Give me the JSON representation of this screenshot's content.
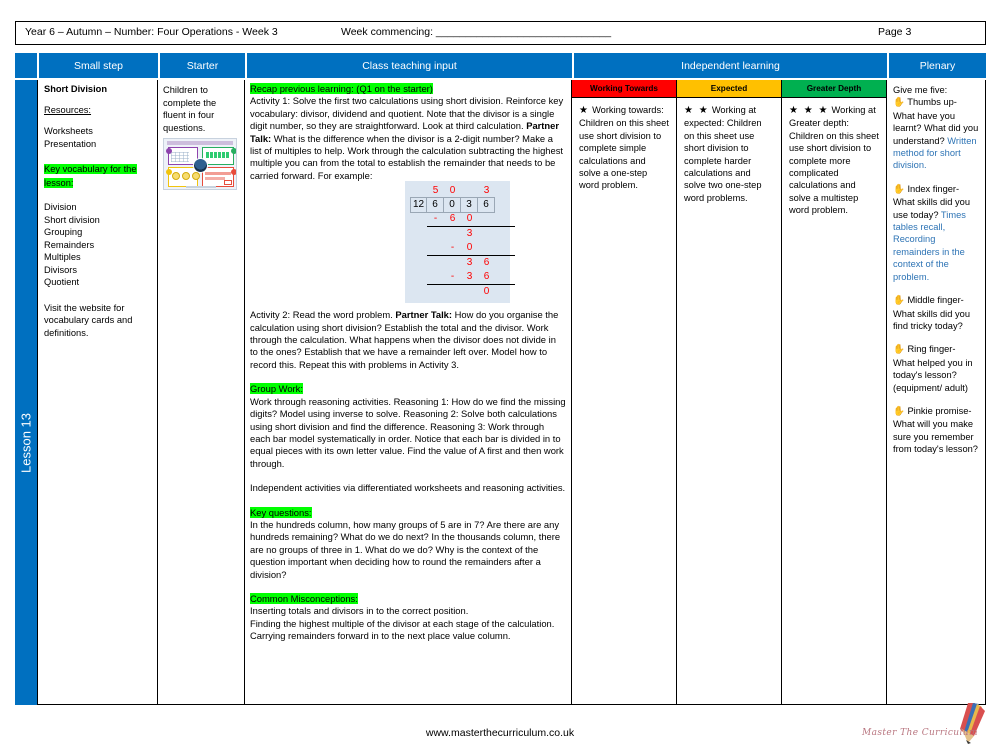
{
  "topbar": {
    "title": "Year 6 – Autumn – Number: Four Operations - Week 3",
    "week_commencing": "Week commencing: ______________________________",
    "page": "Page 3"
  },
  "headers": {
    "small_step": "Small step",
    "starter": "Starter",
    "class_teaching_input": "Class teaching input",
    "independent_learning": "Independent learning",
    "plenary": "Plenary"
  },
  "lesson_label": "Lesson 13",
  "small_step": {
    "title": "Short Division",
    "resources_label": "Resources:",
    "resources": [
      "Worksheets",
      "Presentation"
    ],
    "vocab_heading": "Key vocabulary for the lesson:",
    "vocabulary": [
      "Division",
      "Short division",
      "Grouping",
      "Remainders",
      "Multiples",
      "Divisors",
      "Quotient"
    ],
    "website_note": "Visit the website for vocabulary cards and definitions."
  },
  "starter": {
    "text": "Children to complete the fluent in four questions.",
    "thumbnail_alt": "fluent-in-four-worksheet-thumbnail"
  },
  "class_teaching": {
    "recap_heading": "Recap previous learning: (Q1 on the starter)",
    "activity1_pre": "Activity 1: Solve the first two calculations using short division. Reinforce key vocabulary: divisor, dividend and quotient. Note that the divisor is a single digit number, so they are straightforward. Look at third calculation. ",
    "partner_talk_1": "Partner Talk:",
    "activity1_post": " What is the difference  when the divisor is a 2-digit number? Make a list of multiples to help. Work through the calculation subtracting the highest multiple you can from the total to establish the remainder that needs to be carried forward. For example:",
    "activity2_pre": "Activity 2: Read the word problem. ",
    "partner_talk_2": "Partner Talk:",
    "activity2_post": " How do you organise the calculation using short division? Establish the total and the divisor. Work through the calculation. What happens when the divisor does not divide in to the ones? Establish that we have a remainder left over. Model how to record this.  Repeat this with problems in Activity 3.",
    "group_work_heading": "Group Work:",
    "group_work_text": "Work through reasoning activities. Reasoning 1: How do we find the missing digits? Model using inverse to solve. Reasoning 2: Solve both calculations using short division and find the difference. Reasoning 3: Work through each bar model systematically in order. Notice that each bar is divided in to equal pieces with its own letter value. Find the value of A first and then work through.",
    "independent_text": "Independent activities via differentiated worksheets and reasoning activities.",
    "key_questions_heading": "Key questions:",
    "key_questions_text": "In the hundreds column, how many groups of 5 are in 7? Are there are any hundreds remaining? What do we do next? In the thousands column, there are no groups of three in 1. What do we do? Why is the context of the question important when deciding how to round the remainders after a division?",
    "misconceptions_heading": "Common Misconceptions:",
    "misconceptions": [
      "Inserting totals and divisors in to the correct position.",
      "Finding the highest multiple of the divisor at each stage of the calculation.",
      "Carrying remainders forward in to the next place value column."
    ],
    "division_example": {
      "quotient": [
        "5",
        "0",
        "3"
      ],
      "divisor": "12",
      "dividend": [
        "6",
        "0",
        "3",
        "6"
      ],
      "step1_subtract": [
        "-",
        "6",
        "0"
      ],
      "step1_remainder": "3",
      "step2_subtract": [
        "-",
        "0"
      ],
      "step2_bring_down": [
        "3",
        "6"
      ],
      "step3_subtract": [
        "-",
        "3",
        "6"
      ],
      "final_remainder": "0"
    }
  },
  "independent_learning": {
    "bands": [
      {
        "label": "Working Towards",
        "color": "#FF0000",
        "stars": "★",
        "star_count": 1,
        "title": "Working towards:",
        "text": "Children on this sheet use short division to complete simple calculations and solve a one-step word problem."
      },
      {
        "label": "Expected",
        "color": "#FFC000",
        "stars": "★ ★",
        "star_count": 2,
        "title": "Working at expected:",
        "text": "Children on this sheet use short division to complete harder calculations and solve two one-step word problems."
      },
      {
        "label": "Greater Depth",
        "color": "#00B050",
        "stars": "★ ★ ★",
        "star_count": 3,
        "title": "Working at Greater depth:",
        "text": "Children on this sheet use short division to complete more complicated calculations and solve a multistep word problem."
      }
    ]
  },
  "plenary": {
    "intro": "Give me five:",
    "items": [
      {
        "icon": "hand-icon",
        "question": "Thumbs up- What have you learnt? What did you understand?",
        "answer": "Written method for short division."
      },
      {
        "icon": "hand-icon",
        "question": "Index finger- What skills did you use today?",
        "answer": "Times tables recall, Recording remainders in the context of the problem."
      },
      {
        "icon": "hand-icon",
        "question": "Middle finger- What skills did you find tricky today?",
        "answer": ""
      },
      {
        "icon": "hand-icon",
        "question": "Ring finger- What helped you in today's lesson? (equipment/ adult)",
        "answer": ""
      },
      {
        "icon": "hand-icon",
        "question": "Pinkie promise- What will you make sure you remember from today's lesson?",
        "answer": ""
      }
    ]
  },
  "footer": {
    "url": "www.masterthecurriculum.co.uk",
    "logo_text": "Master  The  Curriculum"
  }
}
